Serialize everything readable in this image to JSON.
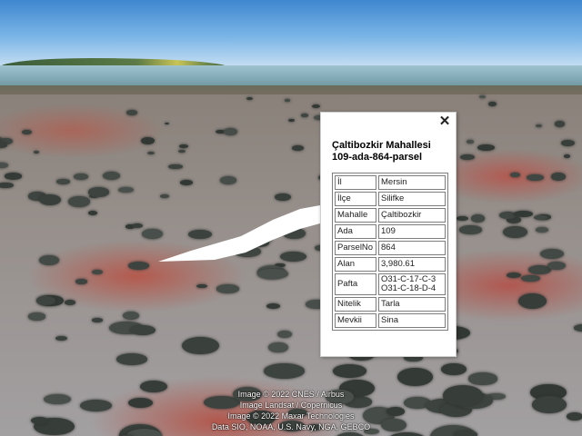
{
  "popup": {
    "close_symbol": "✕",
    "title_line1": "Çaltibozkir Mahallesi",
    "title_line2": "109-ada-864-parsel",
    "rows": [
      {
        "key": "İl",
        "value": "Mersin"
      },
      {
        "key": "İlçe",
        "value": "Silifke"
      },
      {
        "key": "Mahalle",
        "value": "Çaltibozkir"
      },
      {
        "key": "Ada",
        "value": "109"
      },
      {
        "key": "ParselNo",
        "value": "864"
      },
      {
        "key": "Alan",
        "value": "3,980.61"
      },
      {
        "key": "Pafta",
        "value": "O31-C-17-C-3",
        "value2": "O31-C-18-D-4"
      },
      {
        "key": "Nitelik",
        "value": "Tarla"
      },
      {
        "key": "Mevkii",
        "value": "Sina"
      }
    ]
  },
  "attribution": [
    "Image © 2022 CNES / Airbus",
    "Image Landsat / Copernicus",
    "Image © 2022 Maxar Technologies",
    "Data SIO, NOAA, U.S. Navy, NGA, GEBCO"
  ],
  "colors": {
    "sky": "#79b4e6",
    "sea": "#8fb4c2",
    "soil": "#b2584d",
    "popup_bg": "#ffffff"
  }
}
